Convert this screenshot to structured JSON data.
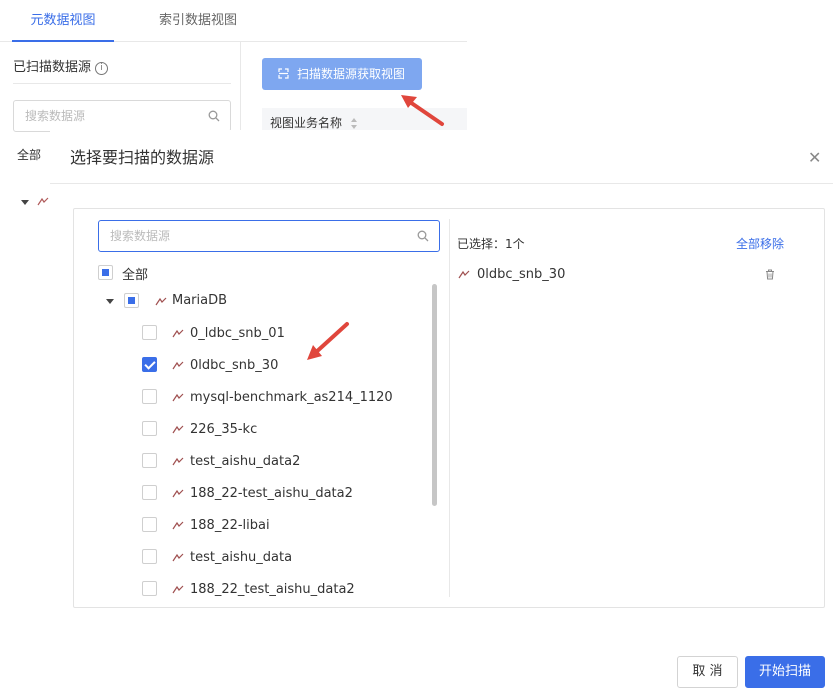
{
  "bg": {
    "tabs": [
      {
        "label": "元数据视图",
        "active": true
      },
      {
        "label": "索引数据视图",
        "active": false
      }
    ],
    "scanned_title": "已扫描数据源",
    "search_placeholder": "搜索数据源",
    "all_label": "全部",
    "scan_view_button": "扫描数据源获取视图",
    "column_header": "视图业务名称"
  },
  "dialog": {
    "title": "选择要扫描的数据源",
    "search_placeholder": "搜索数据源",
    "all_label": "全部",
    "group": {
      "label": "MariaDB",
      "expanded": true,
      "state": "indeterminate"
    },
    "items": [
      {
        "label": "0_ldbc_snb_01",
        "checked": false
      },
      {
        "label": "0ldbc_snb_30",
        "checked": true
      },
      {
        "label": "mysql-benchmark_as214_1120",
        "checked": false
      },
      {
        "label": "226_35-kc",
        "checked": false
      },
      {
        "label": "test_aishu_data2",
        "checked": false
      },
      {
        "label": "188_22-test_aishu_data2",
        "checked": false
      },
      {
        "label": "188_22-libai",
        "checked": false
      },
      {
        "label": "test_aishu_data",
        "checked": false
      },
      {
        "label": "188_22_test_aishu_data2",
        "checked": false
      }
    ],
    "selected_count_text": "已选择：1个",
    "remove_all": "全部移除",
    "selected": [
      {
        "label": "0ldbc_snb_30"
      }
    ],
    "cancel": "取 消",
    "start": "开始扫描"
  },
  "colors": {
    "accent": "#3a6ee8",
    "arrow": "#e0463c"
  }
}
